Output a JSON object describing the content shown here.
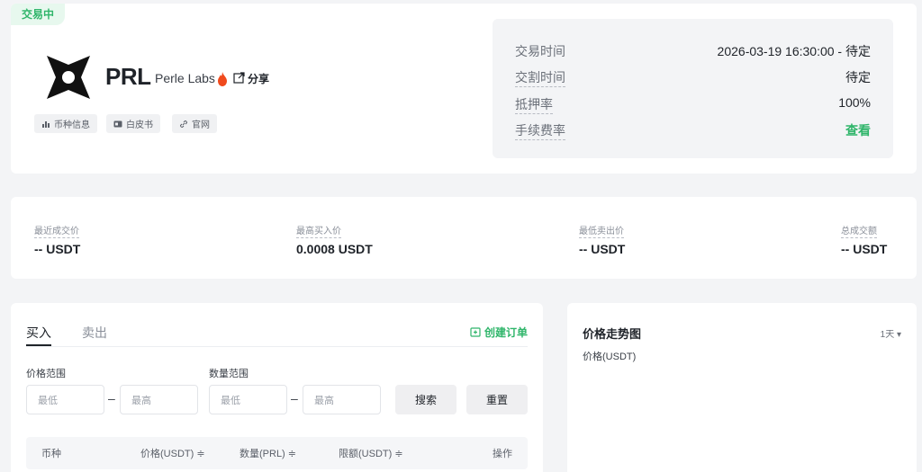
{
  "status_tag": "交易中",
  "project": {
    "symbol": "PRL",
    "name": "Perle Labs",
    "share_label": "分享",
    "links": [
      {
        "label": "币种信息",
        "icon": "chart-icon"
      },
      {
        "label": "白皮书",
        "icon": "document-icon"
      },
      {
        "label": "官网",
        "icon": "link-icon"
      }
    ]
  },
  "info": {
    "trade_time_label": "交易时间",
    "trade_time_value": "2026-03-19 16:30:00 - 待定",
    "delivery_time_label": "交割时间",
    "delivery_time_value": "待定",
    "collateral_label": "抵押率",
    "collateral_value": "100%",
    "fee_label": "手续费率",
    "fee_value": "查看"
  },
  "stats": [
    {
      "label": "最近成交价",
      "value": "-- USDT"
    },
    {
      "label": "最高买入价",
      "value": "0.0008 USDT"
    },
    {
      "label": "最低卖出价",
      "value": "-- USDT"
    },
    {
      "label": "总成交额",
      "value": "-- USDT"
    }
  ],
  "orders": {
    "tab_buy": "买入",
    "tab_sell": "卖出",
    "create_label": "创建订单",
    "price_range_label": "价格范围",
    "qty_range_label": "数量范围",
    "min_placeholder": "最低",
    "max_placeholder": "最高",
    "search_label": "搜索",
    "reset_label": "重置",
    "columns": [
      "币种",
      "价格(USDT) ≑",
      "数量(PRL) ≑",
      "限额(USDT) ≑",
      "操作"
    ]
  },
  "chart": {
    "title": "价格走势图",
    "period": "1天 ▾",
    "y_label": "价格(USDT)"
  },
  "colors": {
    "accent": "#2fb56a",
    "fire": "#f04a1d"
  }
}
